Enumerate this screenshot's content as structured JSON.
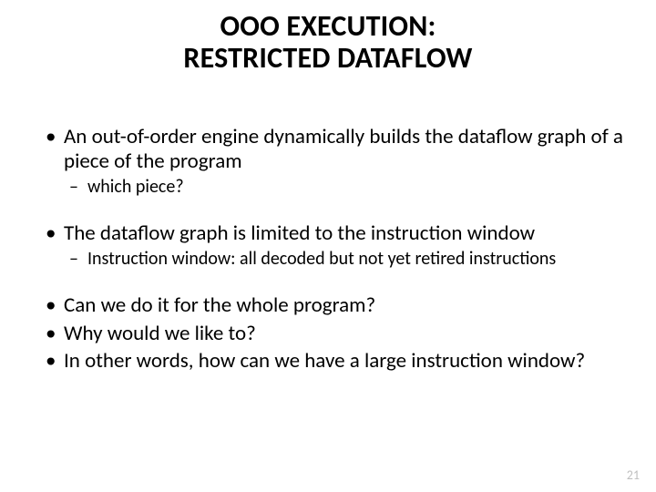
{
  "title_line1": "OOO EXECUTION:",
  "title_line2": "RESTRICTED DATAFLOW",
  "items": {
    "b1": "An out-of-order engine dynamically builds the dataflow graph of a piece of the program",
    "b1_sub1": "which piece?",
    "b2": "The dataflow graph is limited to the instruction window",
    "b2_sub1": "Instruction window: all decoded but not yet retired instructions",
    "b3": "Can we do it for the whole program?",
    "b4": "Why would we like to?",
    "b5": "In other words, how can we have a large instruction window?"
  },
  "page_number": "21"
}
